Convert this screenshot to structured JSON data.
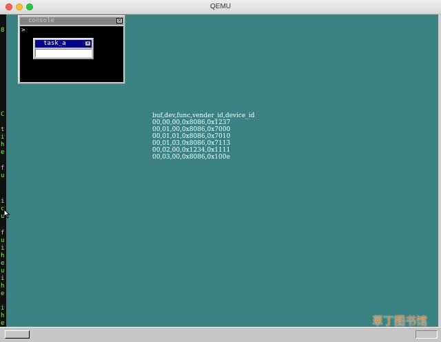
{
  "window": {
    "title": "QEMU"
  },
  "terminal": {
    "chars": [
      "8",
      "C",
      "t",
      "i",
      "h",
      "e",
      "f",
      "u",
      "i",
      "c",
      "u",
      "f",
      "u",
      "i",
      "h",
      "e",
      "u",
      "i",
      "h",
      "e",
      "i",
      "h",
      "e"
    ]
  },
  "console": {
    "title": "console",
    "prompt": ">"
  },
  "task_a": {
    "title": "task_a",
    "input_value": ""
  },
  "pci": {
    "header": "buf,dev,func,vender_id,device_id",
    "rows": [
      "00,00,00,0x8086,0x1237",
      "00,01,00,0x8086,0x7000",
      "00,01,01,0x8086,0x7010",
      "00,01,03,0x8086,0x7113",
      "00,02,00,0x1234,0x1111",
      "00,03,00,0x8086,0x100e"
    ]
  },
  "watermark": {
    "text": "草丁图书馆"
  },
  "colors": {
    "desktop": "#3b8282",
    "task_title_active": "#000084",
    "console_title_inactive": "#848484"
  }
}
